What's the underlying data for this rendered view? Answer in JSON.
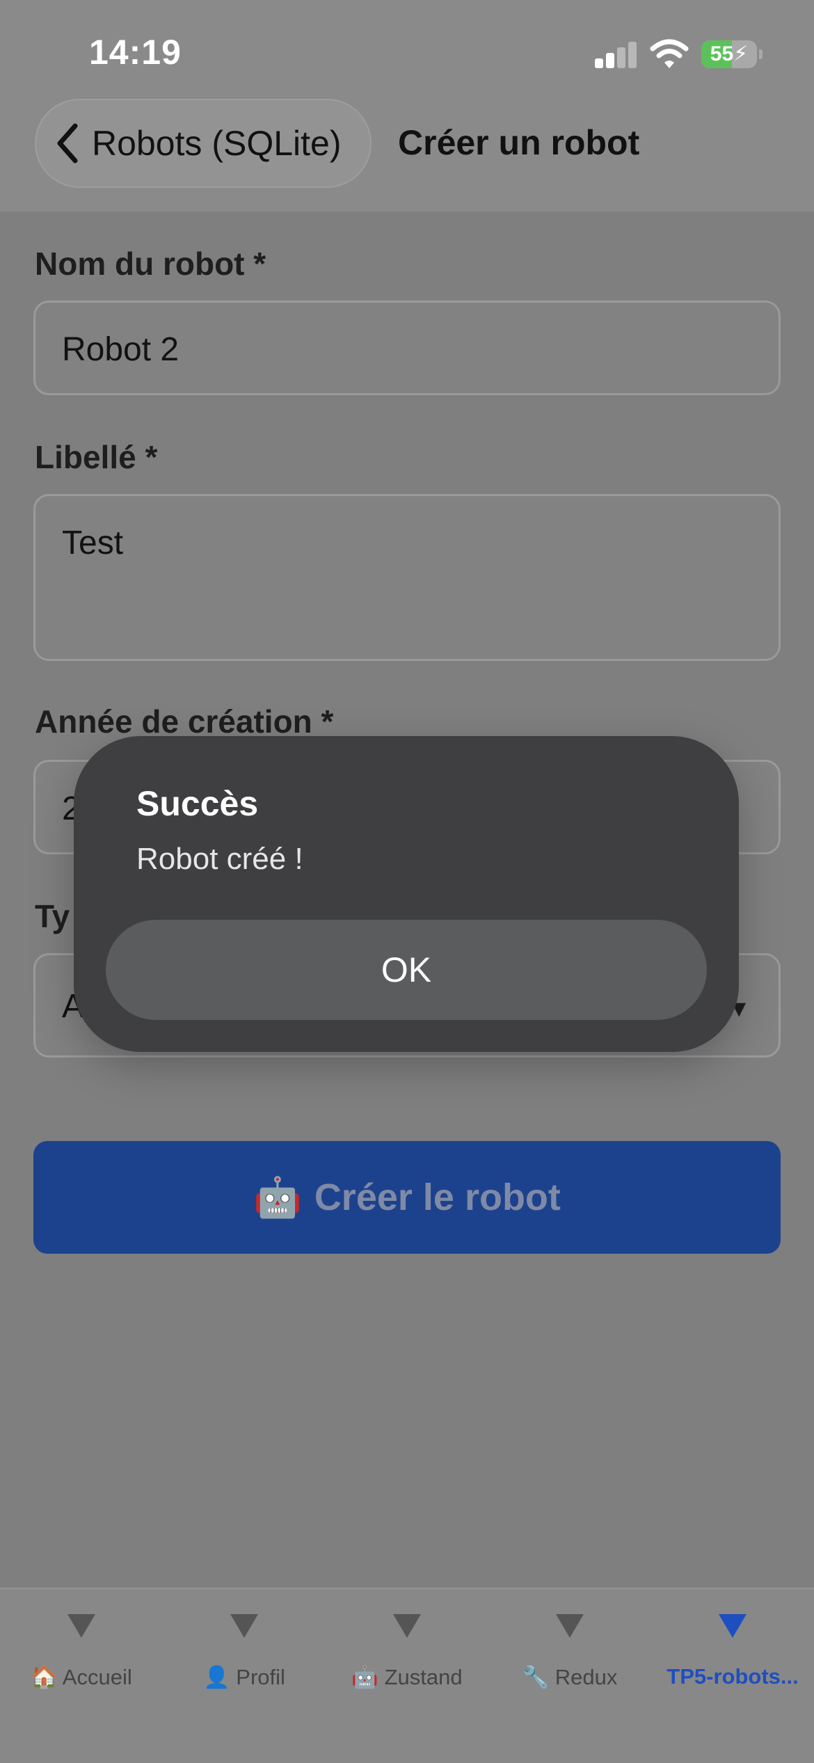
{
  "status_bar": {
    "time": "14:19",
    "battery_level": "55",
    "battery_percent": 55,
    "battery_color": "#5dc15b",
    "signal_icon": "signal-bars-icon",
    "wifi_icon": "wifi-icon",
    "charging_icon": "bolt-icon"
  },
  "header": {
    "back_label": "Robots (SQLite)",
    "back_icon": "chevron-left-icon",
    "title": "Créer un robot"
  },
  "form": {
    "name_label": "Nom du robot *",
    "name_value": "Robot 2",
    "libelle_label": "Libellé *",
    "libelle_value": "Test",
    "year_label": "Année de création *",
    "year_value_visible": "2",
    "type_label_visible": "Ty",
    "type_value_visible": "A",
    "type_arrow": "▼"
  },
  "create_button": {
    "emoji": "🤖",
    "label": "Créer le robot",
    "color": "#1d428d"
  },
  "tabs": [
    {
      "emoji_label": "🏠 Accueil",
      "active": false
    },
    {
      "emoji_label": "👤 Profil",
      "active": false
    },
    {
      "emoji_label": "🤖 Zustand",
      "active": false
    },
    {
      "emoji_label": "🔧 Redux",
      "active": false
    },
    {
      "emoji_label": "TP5-robots...",
      "active": true
    }
  ],
  "alert": {
    "title": "Succès",
    "message": "Robot créé !",
    "ok_label": "OK"
  },
  "colors": {
    "active_tab": "#1e4fbf",
    "overlay_background": "#7f7f7f",
    "alert_background": "#3f3f41"
  }
}
